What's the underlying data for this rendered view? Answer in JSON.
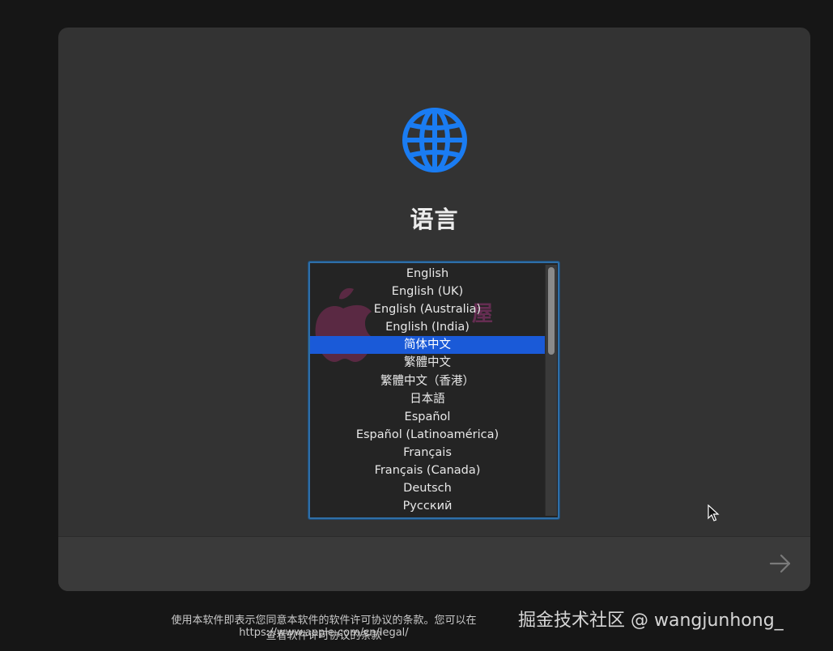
{
  "screen": {
    "title": "语言",
    "icon": "globe-icon",
    "accent_color": "#1a7cf2",
    "selection_color": "#1a5ad8"
  },
  "language_list": {
    "items": [
      "English",
      "English (UK)",
      "English (Australia)",
      "English (India)",
      "简体中文",
      "繁體中文",
      "繁體中文（香港）",
      "日本語",
      "Español",
      "Español (Latinoamérica)",
      "Français",
      "Français (Canada)",
      "Deutsch",
      "Русский"
    ],
    "selected": "简体中文",
    "watermark_text": "屋"
  },
  "footer": {
    "next_icon": "arrow-right-icon"
  },
  "legal": {
    "line1": "使用本软件即表示您同意本软件的软件许可协议的条款。您可以在 https://www.apple.com/cn/legal/",
    "line2": "查看软件许可协议的条款"
  },
  "overlay": {
    "watermark": "掘金技术社区 @ wangjunhong_"
  }
}
